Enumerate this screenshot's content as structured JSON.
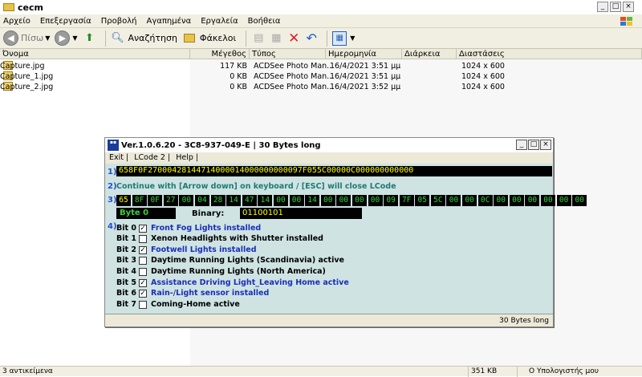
{
  "window": {
    "title": "cecm"
  },
  "menu": [
    "Αρχείο",
    "Επεξεργασία",
    "Προβολή",
    "Αγαπημένα",
    "Εργαλεία",
    "Βοήθεια"
  ],
  "toolbar": {
    "back_label": "Πίσω",
    "search_label": "Αναζήτηση",
    "folders_label": "Φάκελοι"
  },
  "columns": [
    "Όνομα",
    "Μέγεθος",
    "Τύπος",
    "Ημερομηνία τροποπ...",
    "Διάρκεια",
    "Διαστάσεις"
  ],
  "files": [
    {
      "name": "Capture.jpg",
      "size": "117 KB",
      "type": "ACDSee Photo Man...",
      "date": "16/4/2021 3:51 μμ",
      "duration": "",
      "dims": "1024 x 600"
    },
    {
      "name": "Capture_1.jpg",
      "size": "0 KB",
      "type": "ACDSee Photo Man...",
      "date": "16/4/2021 3:51 μμ",
      "duration": "",
      "dims": "1024 x 600"
    },
    {
      "name": "Capture_2.jpg",
      "size": "0 KB",
      "type": "ACDSee Photo Man...",
      "date": "16/4/2021 3:52 μμ",
      "duration": "",
      "dims": "1024 x 600"
    }
  ],
  "status": {
    "items": "3 αντικείμενα",
    "size": "351 KB",
    "location": "Ο Υπολογιστής μου"
  },
  "dialog": {
    "title": "Ver.1.0.6.20 -  3C8-937-049-E | 30 Bytes long",
    "menu": [
      "Exit |",
      "LCode 2 |",
      "Help |"
    ],
    "step1": "1)",
    "code": "658F0F27000428144714000014000000000097F055C00000C000000000000",
    "step2": "2)",
    "instruction": "Continue with [Arrow down] on keyboard / [ESC] will close LCode",
    "step3": "3)",
    "bytes": [
      "65",
      "8F",
      "0F",
      "27",
      "00",
      "04",
      "28",
      "14",
      "47",
      "14",
      "00",
      "00",
      "14",
      "00",
      "00",
      "00",
      "00",
      "09",
      "7F",
      "05",
      "5C",
      "00",
      "00",
      "0C",
      "00",
      "00",
      "00",
      "00",
      "00",
      "00"
    ],
    "byte_label": "Byte 0",
    "binary_label": "Binary:",
    "binary": "01100101",
    "step4": "4)",
    "bits": [
      {
        "bit": "Bit 0",
        "checked": true,
        "label": "Front Fog Lights installed"
      },
      {
        "bit": "Bit 1",
        "checked": false,
        "label": "Xenon Headlights with Shutter installed"
      },
      {
        "bit": "Bit 2",
        "checked": true,
        "label": "Footwell Lights installed"
      },
      {
        "bit": "Bit 3",
        "checked": false,
        "label": "Daytime Running Lights (Scandinavia) active"
      },
      {
        "bit": "Bit 4",
        "checked": false,
        "label": "Daytime Running Lights (North America)"
      },
      {
        "bit": "Bit 5",
        "checked": true,
        "label": "Assistance Driving Light_Leaving Home active"
      },
      {
        "bit": "Bit 6",
        "checked": true,
        "label": "Rain-/Light sensor installed"
      },
      {
        "bit": "Bit 7",
        "checked": false,
        "label": "Coming-Home active"
      }
    ],
    "status": "30 Bytes long"
  }
}
